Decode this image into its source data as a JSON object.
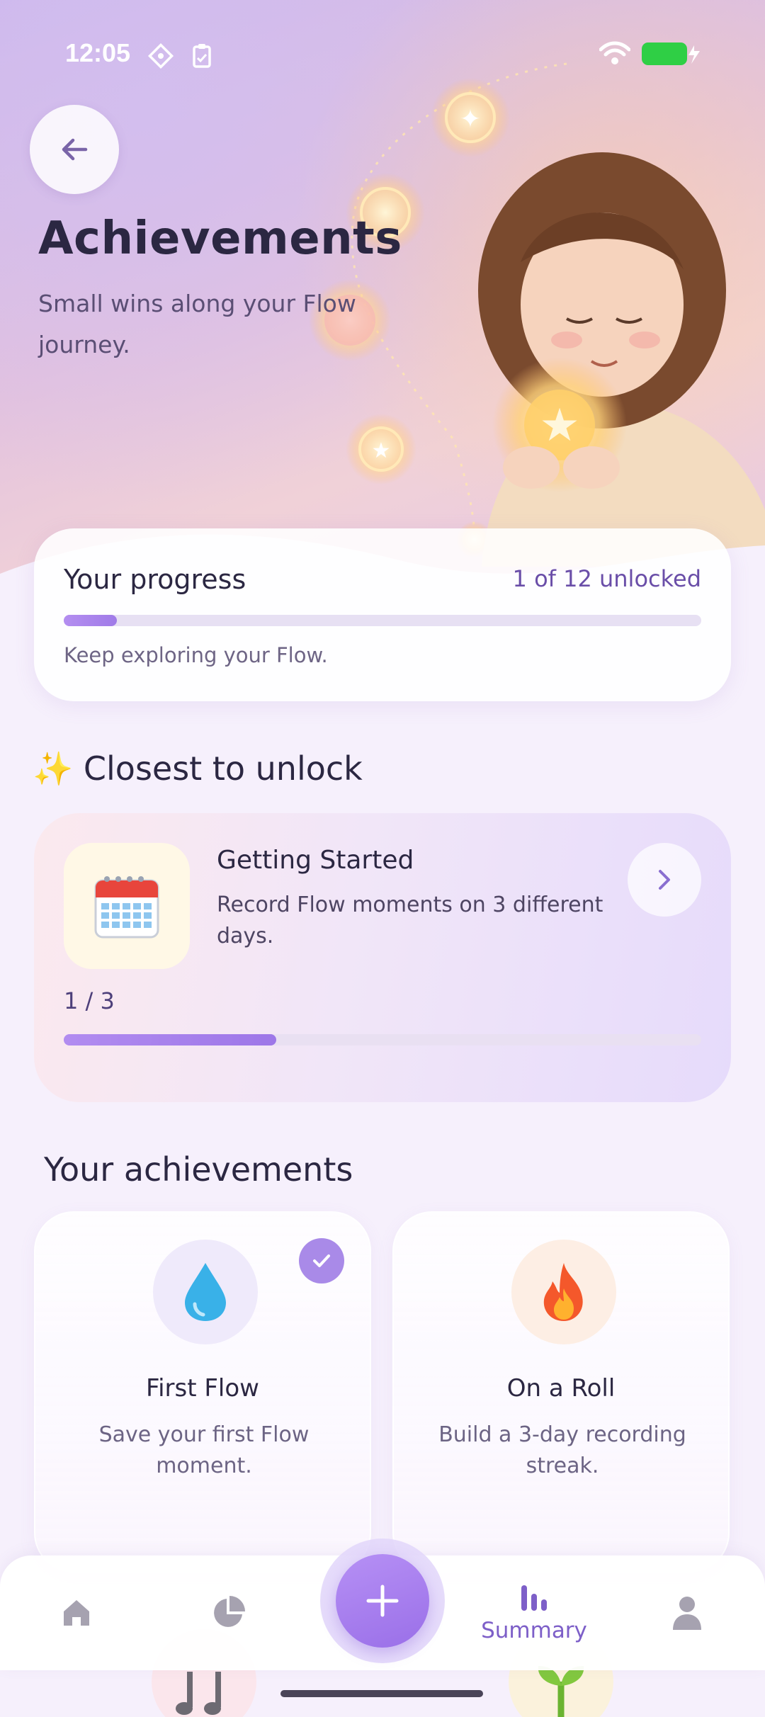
{
  "status_bar": {
    "time": "12:05",
    "icons": [
      "gear-notification-icon",
      "clipboard-icon",
      "wifi-icon",
      "battery-charging-icon"
    ],
    "battery_color": "#2fcf45"
  },
  "header": {
    "back_icon": "arrow-left-icon",
    "title": "Achievements",
    "subtitle": "Small wins along your Flow journey."
  },
  "progress": {
    "title": "Your progress",
    "count_text": "1 of 12 unlocked",
    "fraction": 0.0833,
    "hint": "Keep exploring your Flow."
  },
  "closest": {
    "heading_emoji": "✨",
    "heading": "Closest to unlock",
    "item": {
      "icon": "calendar-icon",
      "name": "Getting Started",
      "description": "Record Flow moments on 3 different days.",
      "ratio_text": "1 / 3",
      "fraction": 0.3333
    }
  },
  "achievements": {
    "heading": "Your achievements",
    "items": [
      {
        "icon": "droplet-icon",
        "emoji": "💧",
        "name": "First Flow",
        "description": "Save your first Flow moment.",
        "unlocked": true,
        "bg": "#efeafb"
      },
      {
        "icon": "fire-icon",
        "emoji": "🔥",
        "name": "On a Roll",
        "description": "Build a 3-day recording streak.",
        "unlocked": false,
        "bg": "#fdeee4"
      }
    ]
  },
  "bottom_nav": {
    "items": [
      {
        "icon": "home-icon",
        "label": ""
      },
      {
        "icon": "pie-chart-icon",
        "label": ""
      },
      {
        "icon": "plus-icon",
        "label": ""
      },
      {
        "icon": "bar-chart-icon",
        "label": "Summary",
        "active": true
      },
      {
        "icon": "profile-icon",
        "label": ""
      }
    ]
  },
  "colors": {
    "accent": "#9d77e8",
    "title": "#2b2742",
    "nav_active": "#7d5fc8"
  }
}
